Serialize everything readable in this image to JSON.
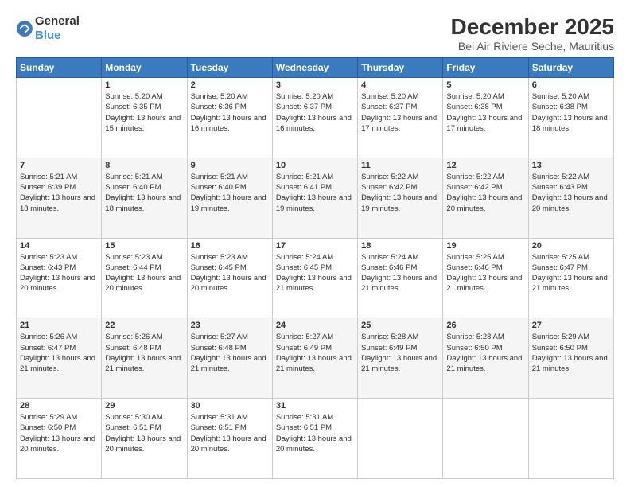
{
  "header": {
    "logo_general": "General",
    "logo_blue": "Blue",
    "month": "December 2025",
    "location": "Bel Air Riviere Seche, Mauritius"
  },
  "weekdays": [
    "Sunday",
    "Monday",
    "Tuesday",
    "Wednesday",
    "Thursday",
    "Friday",
    "Saturday"
  ],
  "weeks": [
    [
      {
        "day": "",
        "sunrise": "",
        "sunset": "",
        "daylight": ""
      },
      {
        "day": "1",
        "sunrise": "Sunrise: 5:20 AM",
        "sunset": "Sunset: 6:35 PM",
        "daylight": "Daylight: 13 hours and 15 minutes."
      },
      {
        "day": "2",
        "sunrise": "Sunrise: 5:20 AM",
        "sunset": "Sunset: 6:36 PM",
        "daylight": "Daylight: 13 hours and 16 minutes."
      },
      {
        "day": "3",
        "sunrise": "Sunrise: 5:20 AM",
        "sunset": "Sunset: 6:37 PM",
        "daylight": "Daylight: 13 hours and 16 minutes."
      },
      {
        "day": "4",
        "sunrise": "Sunrise: 5:20 AM",
        "sunset": "Sunset: 6:37 PM",
        "daylight": "Daylight: 13 hours and 17 minutes."
      },
      {
        "day": "5",
        "sunrise": "Sunrise: 5:20 AM",
        "sunset": "Sunset: 6:38 PM",
        "daylight": "Daylight: 13 hours and 17 minutes."
      },
      {
        "day": "6",
        "sunrise": "Sunrise: 5:20 AM",
        "sunset": "Sunset: 6:38 PM",
        "daylight": "Daylight: 13 hours and 18 minutes."
      }
    ],
    [
      {
        "day": "7",
        "sunrise": "Sunrise: 5:21 AM",
        "sunset": "Sunset: 6:39 PM",
        "daylight": "Daylight: 13 hours and 18 minutes."
      },
      {
        "day": "8",
        "sunrise": "Sunrise: 5:21 AM",
        "sunset": "Sunset: 6:40 PM",
        "daylight": "Daylight: 13 hours and 18 minutes."
      },
      {
        "day": "9",
        "sunrise": "Sunrise: 5:21 AM",
        "sunset": "Sunset: 6:40 PM",
        "daylight": "Daylight: 13 hours and 19 minutes."
      },
      {
        "day": "10",
        "sunrise": "Sunrise: 5:21 AM",
        "sunset": "Sunset: 6:41 PM",
        "daylight": "Daylight: 13 hours and 19 minutes."
      },
      {
        "day": "11",
        "sunrise": "Sunrise: 5:22 AM",
        "sunset": "Sunset: 6:42 PM",
        "daylight": "Daylight: 13 hours and 19 minutes."
      },
      {
        "day": "12",
        "sunrise": "Sunrise: 5:22 AM",
        "sunset": "Sunset: 6:42 PM",
        "daylight": "Daylight: 13 hours and 20 minutes."
      },
      {
        "day": "13",
        "sunrise": "Sunrise: 5:22 AM",
        "sunset": "Sunset: 6:43 PM",
        "daylight": "Daylight: 13 hours and 20 minutes."
      }
    ],
    [
      {
        "day": "14",
        "sunrise": "Sunrise: 5:23 AM",
        "sunset": "Sunset: 6:43 PM",
        "daylight": "Daylight: 13 hours and 20 minutes."
      },
      {
        "day": "15",
        "sunrise": "Sunrise: 5:23 AM",
        "sunset": "Sunset: 6:44 PM",
        "daylight": "Daylight: 13 hours and 20 minutes."
      },
      {
        "day": "16",
        "sunrise": "Sunrise: 5:23 AM",
        "sunset": "Sunset: 6:45 PM",
        "daylight": "Daylight: 13 hours and 20 minutes."
      },
      {
        "day": "17",
        "sunrise": "Sunrise: 5:24 AM",
        "sunset": "Sunset: 6:45 PM",
        "daylight": "Daylight: 13 hours and 21 minutes."
      },
      {
        "day": "18",
        "sunrise": "Sunrise: 5:24 AM",
        "sunset": "Sunset: 6:46 PM",
        "daylight": "Daylight: 13 hours and 21 minutes."
      },
      {
        "day": "19",
        "sunrise": "Sunrise: 5:25 AM",
        "sunset": "Sunset: 6:46 PM",
        "daylight": "Daylight: 13 hours and 21 minutes."
      },
      {
        "day": "20",
        "sunrise": "Sunrise: 5:25 AM",
        "sunset": "Sunset: 6:47 PM",
        "daylight": "Daylight: 13 hours and 21 minutes."
      }
    ],
    [
      {
        "day": "21",
        "sunrise": "Sunrise: 5:26 AM",
        "sunset": "Sunset: 6:47 PM",
        "daylight": "Daylight: 13 hours and 21 minutes."
      },
      {
        "day": "22",
        "sunrise": "Sunrise: 5:26 AM",
        "sunset": "Sunset: 6:48 PM",
        "daylight": "Daylight: 13 hours and 21 minutes."
      },
      {
        "day": "23",
        "sunrise": "Sunrise: 5:27 AM",
        "sunset": "Sunset: 6:48 PM",
        "daylight": "Daylight: 13 hours and 21 minutes."
      },
      {
        "day": "24",
        "sunrise": "Sunrise: 5:27 AM",
        "sunset": "Sunset: 6:49 PM",
        "daylight": "Daylight: 13 hours and 21 minutes."
      },
      {
        "day": "25",
        "sunrise": "Sunrise: 5:28 AM",
        "sunset": "Sunset: 6:49 PM",
        "daylight": "Daylight: 13 hours and 21 minutes."
      },
      {
        "day": "26",
        "sunrise": "Sunrise: 5:28 AM",
        "sunset": "Sunset: 6:50 PM",
        "daylight": "Daylight: 13 hours and 21 minutes."
      },
      {
        "day": "27",
        "sunrise": "Sunrise: 5:29 AM",
        "sunset": "Sunset: 6:50 PM",
        "daylight": "Daylight: 13 hours and 21 minutes."
      }
    ],
    [
      {
        "day": "28",
        "sunrise": "Sunrise: 5:29 AM",
        "sunset": "Sunset: 6:50 PM",
        "daylight": "Daylight: 13 hours and 20 minutes."
      },
      {
        "day": "29",
        "sunrise": "Sunrise: 5:30 AM",
        "sunset": "Sunset: 6:51 PM",
        "daylight": "Daylight: 13 hours and 20 minutes."
      },
      {
        "day": "30",
        "sunrise": "Sunrise: 5:31 AM",
        "sunset": "Sunset: 6:51 PM",
        "daylight": "Daylight: 13 hours and 20 minutes."
      },
      {
        "day": "31",
        "sunrise": "Sunrise: 5:31 AM",
        "sunset": "Sunset: 6:51 PM",
        "daylight": "Daylight: 13 hours and 20 minutes."
      },
      {
        "day": "",
        "sunrise": "",
        "sunset": "",
        "daylight": ""
      },
      {
        "day": "",
        "sunrise": "",
        "sunset": "",
        "daylight": ""
      },
      {
        "day": "",
        "sunrise": "",
        "sunset": "",
        "daylight": ""
      }
    ]
  ]
}
